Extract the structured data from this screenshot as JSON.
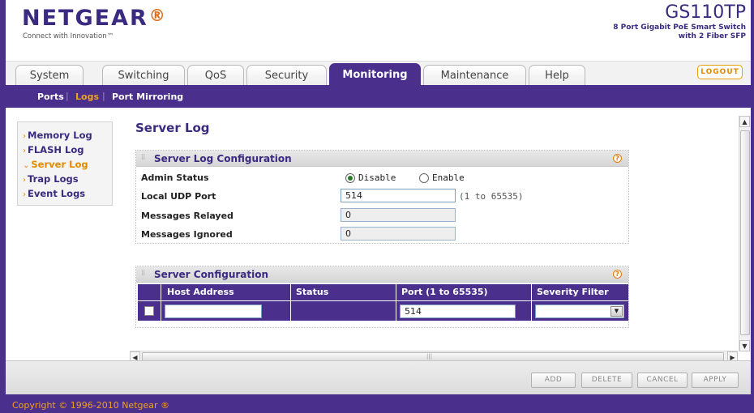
{
  "brand": {
    "logo": "NETGEAR",
    "logo_mark": "®",
    "tagline": "Connect with Innovation™",
    "model": "GS110TP",
    "model_desc_1": "8 Port Gigabit PoE Smart Switch",
    "model_desc_2": "with 2 Fiber SFP"
  },
  "tabs": [
    {
      "label": "System",
      "active": false
    },
    {
      "label": "Switching",
      "active": false
    },
    {
      "label": "QoS",
      "active": false
    },
    {
      "label": "Security",
      "active": false
    },
    {
      "label": "Monitoring",
      "active": true
    },
    {
      "label": "Maintenance",
      "active": false
    },
    {
      "label": "Help",
      "active": false
    }
  ],
  "logout_label": "LOGOUT",
  "subnav": [
    {
      "label": "Ports",
      "active": false
    },
    {
      "label": "Logs",
      "active": true
    },
    {
      "label": "Port Mirroring",
      "active": false
    }
  ],
  "subnav_sep": "|",
  "left_menu": [
    {
      "label": "Memory Log",
      "arrow": "›",
      "active": false
    },
    {
      "label": "FLASH Log",
      "arrow": "›",
      "active": false
    },
    {
      "label": "Server Log",
      "arrow": "⌄",
      "active": true
    },
    {
      "label": "Trap Logs",
      "arrow": "›",
      "active": false
    },
    {
      "label": "Event Logs",
      "arrow": "›",
      "active": false
    }
  ],
  "page_title": "Server Log",
  "log_config": {
    "title": "Server Log Configuration",
    "help": "?",
    "admin_status_label": "Admin Status",
    "admin_status_options": [
      "Disable",
      "Enable"
    ],
    "admin_status_selected": "Disable",
    "udp_port_label": "Local UDP Port",
    "udp_port_value": "514",
    "udp_port_hint": "(1 to 65535)",
    "relayed_label": "Messages Relayed",
    "relayed_value": "0",
    "ignored_label": "Messages Ignored",
    "ignored_value": "0"
  },
  "server_config": {
    "title": "Server Configuration",
    "help": "?",
    "columns": [
      "Host Address",
      "Status",
      "Port (1 to 65535)",
      "Severity Filter"
    ],
    "row": {
      "host": "",
      "status": "",
      "port": "514",
      "severity": ""
    }
  },
  "scroll_arrows": {
    "up": "▲",
    "down": "▼",
    "left": "◀",
    "right": "▶",
    "grip": "|||"
  },
  "buttons": {
    "add": "ADD",
    "delete": "DELETE",
    "cancel": "CANCEL",
    "apply": "APPLY"
  },
  "copyright": "Copyright © 1996-2010 Netgear ®",
  "colors": {
    "brand_purple": "#4b2f8c",
    "accent_orange": "#e08a00"
  }
}
